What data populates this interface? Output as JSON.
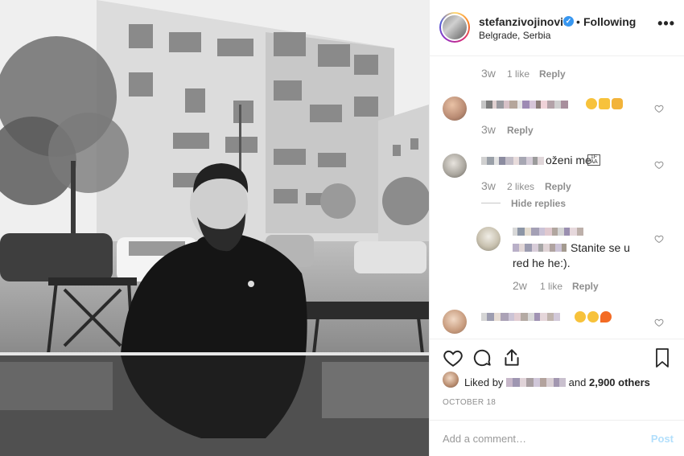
{
  "post": {
    "username": "stefanzivojinovic",
    "verified_icon": "check-icon",
    "separator": "•",
    "follow_status": "Following",
    "location": "Belgrade, Serbia",
    "more_icon": "•••"
  },
  "comments": [
    {
      "time": "3w",
      "likes": "1 like",
      "reply": "Reply"
    },
    {
      "text": "",
      "emojis": [
        "😍",
        "👍",
        "👏"
      ],
      "time": "3w",
      "reply": "Reply"
    },
    {
      "text": "oženi me",
      "time": "3w",
      "likes": "2 likes",
      "reply": "Reply",
      "hide_replies": "Hide replies"
    },
    {
      "text_line1": "Stanite se u",
      "text_line2": "red he he:).",
      "time": "2w",
      "likes": "1 like",
      "reply": "Reply"
    },
    {
      "emojis": [
        "😍",
        "😍",
        "🔥"
      ]
    }
  ],
  "footer": {
    "liked_prefix": "Liked by",
    "liked_and": "and",
    "liked_others": "2,900 others",
    "date": "OCTOBER 18",
    "add_comment_placeholder": "Add a comment…",
    "post_button": "Post"
  },
  "colors": {
    "accent": "#3897f0",
    "muted": "#8e8e8e",
    "post_disabled": "#b2dffc"
  }
}
